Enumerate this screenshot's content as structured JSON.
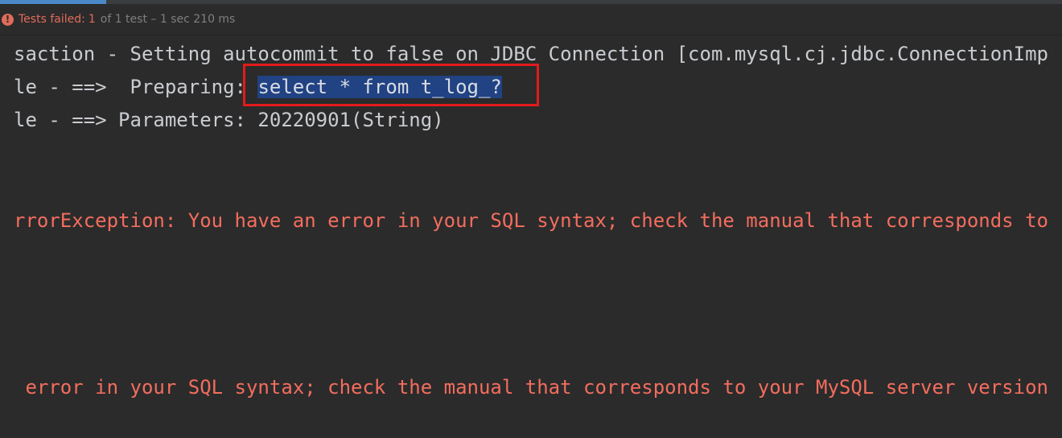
{
  "progress": {
    "fraction": 0.1
  },
  "status": {
    "icon": "error-icon",
    "failed_label": "Tests failed:",
    "failed_count": "1",
    "rest": "of 1 test – 1 sec 210 ms"
  },
  "console": {
    "lines": [
      {
        "text": "saction - Setting autocommit to false on JDBC Connection [com.mysql.cj.jdbc.ConnectionImp"
      },
      {
        "prefix": "le - ==>  Preparing: ",
        "selected": "select * from t_log_?"
      },
      {
        "text": "le - ==> Parameters: 20220901(String)"
      },
      {
        "text": "rrorException: You have an error in your SQL syntax; check the manual that corresponds to"
      },
      {
        "text": " error in your SQL syntax; check the manual that corresponds to your MySQL server version"
      }
    ]
  },
  "colors": {
    "background": "#2b2b2b",
    "text": "#c9ccd1",
    "error_text": "#f36d5e",
    "selection": "#214283",
    "callout": "#e31b1b",
    "failed": "#e06c5a"
  }
}
